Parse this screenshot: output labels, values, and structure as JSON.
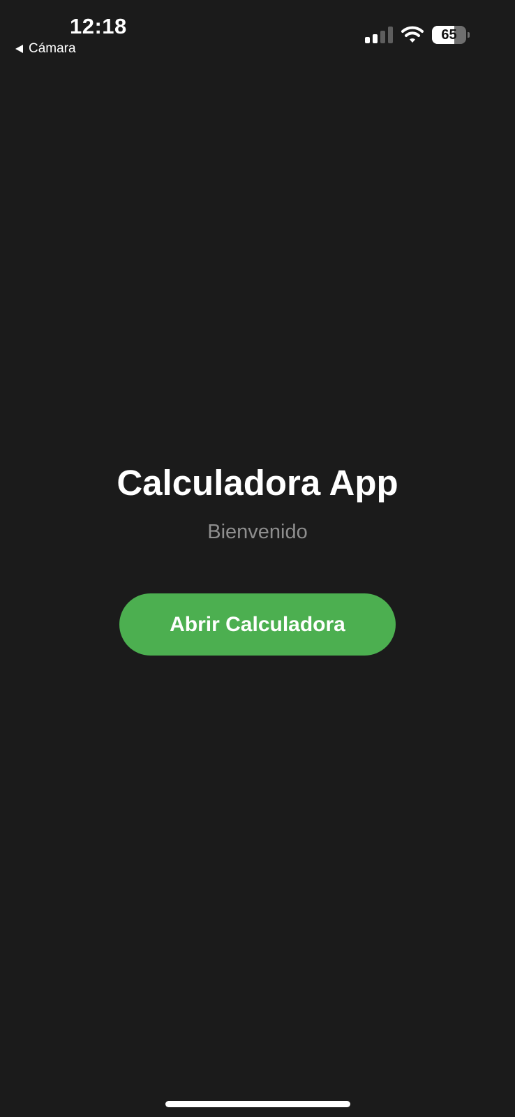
{
  "status_bar": {
    "time": "12:18",
    "back_label": "Cámara",
    "battery_percent": 65,
    "battery_label": "65",
    "signal_bars_active": 2,
    "signal_bars_total": 4
  },
  "main": {
    "title": "Calculadora App",
    "subtitle": "Bienvenido",
    "open_button_label": "Abrir Calculadora"
  },
  "colors": {
    "background": "#1b1b1b",
    "accent": "#4caf50",
    "subtitle": "#8e8e8e"
  },
  "icons": {
    "back": "back-arrow-icon",
    "signal": "cellular-signal-icon",
    "wifi": "wifi-icon",
    "battery": "battery-icon"
  }
}
